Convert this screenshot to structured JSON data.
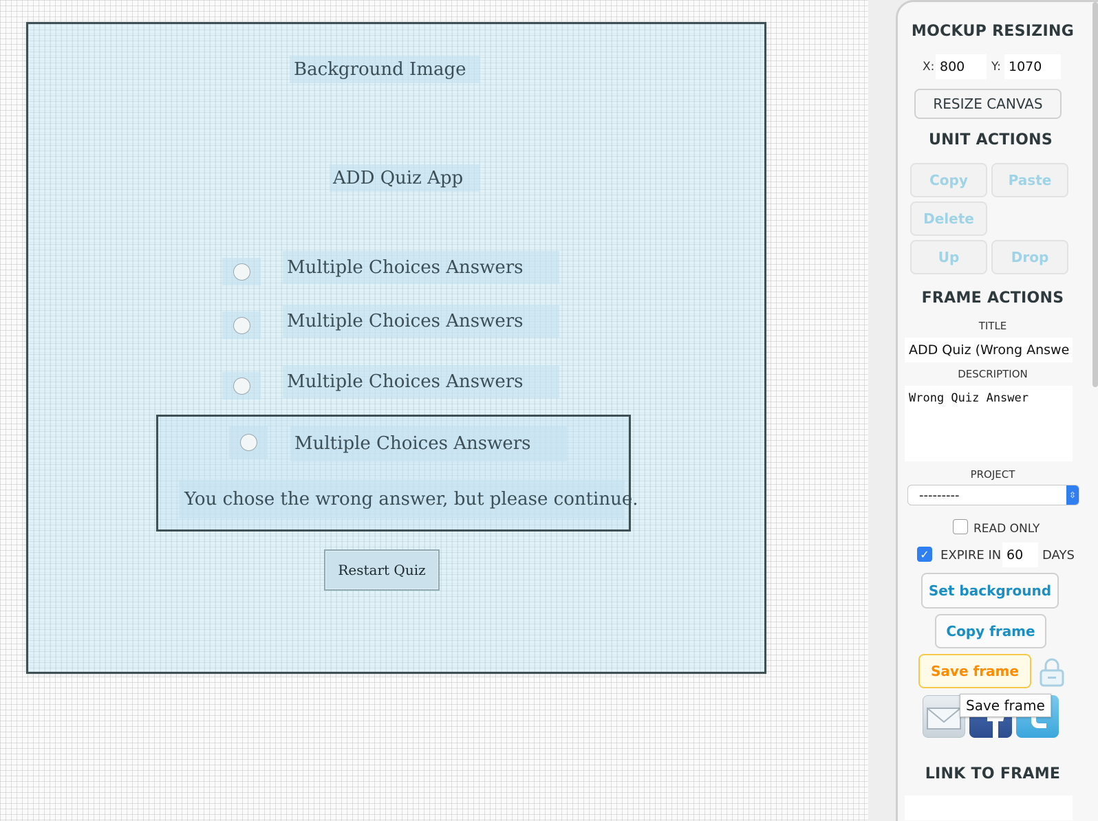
{
  "canvas": {
    "background_label": "Background Image",
    "app_title": "ADD Quiz App",
    "answers": [
      "Multiple Choices Answers",
      "Multiple Choices Answers",
      "Multiple Choices Answers",
      "Multiple Choices Answers"
    ],
    "feedback": "You chose the wrong answer, but please continue.",
    "restart_label": "Restart Quiz"
  },
  "sidebar": {
    "mockup_resizing": "MOCKUP RESIZING",
    "x_label": "X:",
    "x_value": "800",
    "y_label": "Y:",
    "y_value": "1070",
    "resize_button": "RESIZE CANVAS",
    "unit_actions": "UNIT ACTIONS",
    "copy": "Copy",
    "paste": "Paste",
    "delete": "Delete",
    "up": "Up",
    "drop": "Drop",
    "frame_actions": "FRAME ACTIONS",
    "title_label": "TITLE",
    "title_value": "ADD Quiz (Wrong Answe",
    "description_label": "DESCRIPTION",
    "description_value": "Wrong Quiz Answer",
    "project_label": "PROJECT",
    "project_value": "---------",
    "read_only_label": "READ ONLY",
    "expire_label": "EXPIRE IN",
    "expire_value": "60",
    "days_label": "DAYS",
    "set_background": "Set background",
    "copy_frame": "Copy frame",
    "save_frame": "Save frame",
    "tooltip": "Save frame",
    "link_to_frame": "LINK TO FRAME"
  },
  "colors": {
    "accent_blue": "#1a8fc4",
    "save_orange": "#ff8c00",
    "disabled_blue": "#9fd3e6",
    "checkbox_blue": "#2f7ff0"
  },
  "icons": [
    "lock-icon",
    "mail-icon",
    "facebook-icon",
    "twitter-icon",
    "checkmark-icon"
  ]
}
